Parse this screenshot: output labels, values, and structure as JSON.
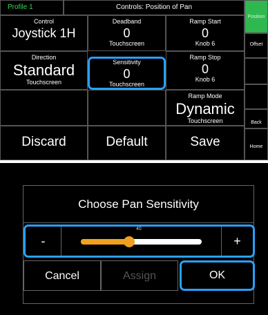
{
  "header": {
    "profile": "Profile 1",
    "title": "Controls: Position of Pan"
  },
  "cells": {
    "control": {
      "label": "Control",
      "value": "Joystick 1H"
    },
    "deadband": {
      "label": "Deadband",
      "value": "0",
      "sub": "Touchscreen"
    },
    "ramp_start": {
      "label": "Ramp Start",
      "value": "0",
      "sub": "Knob 6"
    },
    "direction": {
      "label": "Direction",
      "value": "Standard",
      "sub": "Touchscreen"
    },
    "sensitivity": {
      "label": "Sensitivity",
      "value": "0",
      "sub": "Touchscreen"
    },
    "ramp_stop": {
      "label": "Ramp Stop",
      "value": "0",
      "sub": "Knob 6"
    },
    "ramp_mode": {
      "label": "Ramp Mode",
      "value": "Dynamic",
      "sub": "Touchscreen"
    }
  },
  "actions": {
    "discard": "Discard",
    "default": "Default",
    "save": "Save"
  },
  "side": {
    "position": "Position",
    "offset": "Offset",
    "back": "Back",
    "home": "Home"
  },
  "dialog": {
    "title": "Choose Pan Sensitivity",
    "minus": "-",
    "plus": "+",
    "slider_value": "40",
    "slider_fraction": 0.4,
    "cancel": "Cancel",
    "assign": "Assign",
    "ok": "OK"
  },
  "colors": {
    "accent": "#2aa0ff",
    "profile_text": "#3ad65a",
    "position_tab": "#2fb84f",
    "slider": "#f0a020"
  }
}
